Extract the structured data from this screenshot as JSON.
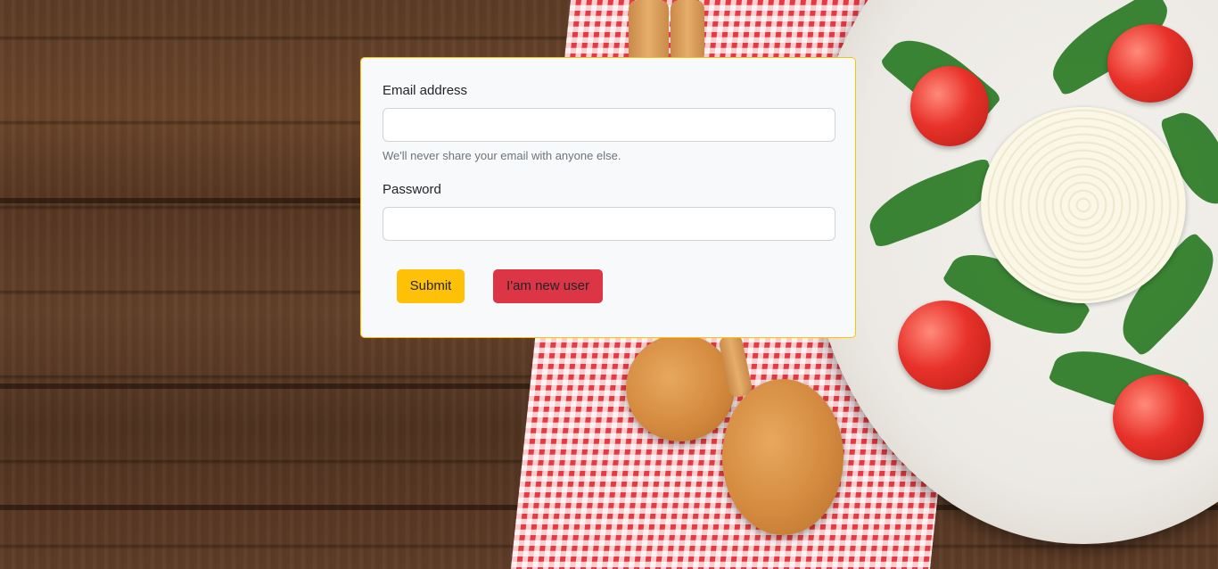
{
  "login_form": {
    "email_label": "Email address",
    "email_value": "",
    "email_help": "We'll never share your email with anyone else.",
    "password_label": "Password",
    "password_value": "",
    "submit_label": "Submit",
    "new_user_label": "I'am new user"
  },
  "colors": {
    "card_border": "#ffc107",
    "card_background": "#f8f9fa",
    "submit_button": "#ffc107",
    "new_user_button": "#dc3545",
    "help_text": "#6c757d"
  }
}
